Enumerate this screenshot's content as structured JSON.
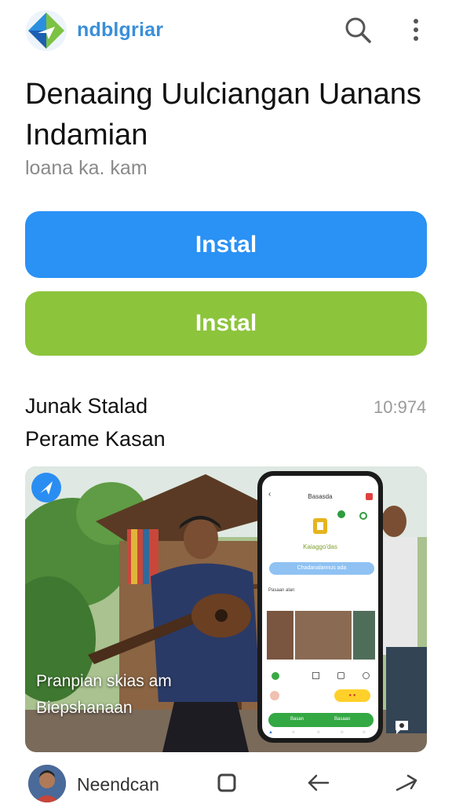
{
  "header": {
    "brand": "ndblgriar",
    "logo_icon": "diamond-arrow-logo-icon",
    "search_icon": "search-icon",
    "more_icon": "more-vertical-icon"
  },
  "app": {
    "title": "Denaaing Uulciangan Uanans Indamian",
    "subtitle": "loana ka. kam"
  },
  "buttons": {
    "install_primary": "Instal",
    "install_secondary": "Instal",
    "colors": {
      "blue": "#2a91f5",
      "green": "#8cc43c"
    }
  },
  "section": {
    "title": "Junak Stalad",
    "time": "10:974",
    "subtitle": "Perame Kasan"
  },
  "media": {
    "caption_line1": "Pranpian skias am",
    "caption_line2": "Biepshanaan",
    "badge_icon": "navigation-arrow-icon",
    "corner_icon": "chat-bubble-icon",
    "phone": {
      "header_title": "Basasda",
      "app_name": "Kaiaggo'das",
      "primary_button": "Chadanalannus ada",
      "section_label": "Pasaan alan",
      "bottom_button_left": "Basan",
      "bottom_button_right": "Basaao"
    }
  },
  "bottom_nav": {
    "user_name": "Neendcan",
    "home_icon": "square-home-icon",
    "back_icon": "arrow-left-icon",
    "forward_icon": "arrow-right-icon"
  }
}
